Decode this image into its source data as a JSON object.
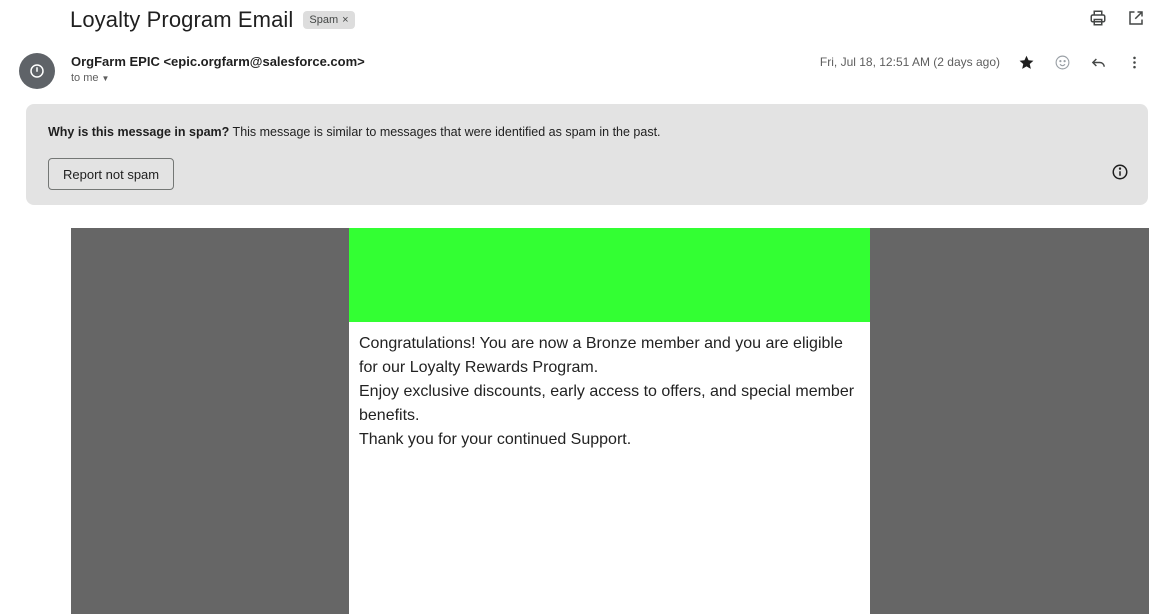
{
  "header": {
    "subject": "Loyalty Program Email",
    "label": "Spam",
    "label_close": "×"
  },
  "sender": {
    "display": "OrgFarm EPIC <epic.orgfarm@salesforce.com>",
    "to": "to me",
    "date": "Fri, Jul 18, 12:51 AM (2 days ago)"
  },
  "spam_banner": {
    "question": "Why is this message in spam?",
    "explanation": " This message is similar to messages that were identified as spam in the past.",
    "button": "Report not spam"
  },
  "email_body": {
    "lines": [
      "Congratulations! You are now a Bronze member and you are eligible for our Loyalty Rewards Program.",
      "Enjoy exclusive discounts, early access to offers, and special member benefits.",
      "Thank you for your continued Support."
    ]
  },
  "icons": [
    "print-icon",
    "open-new-window-icon",
    "avatar-icon",
    "star-icon",
    "emoji-icon",
    "reply-icon",
    "more-options-icon",
    "info-icon"
  ],
  "colors": {
    "green_banner": "#33ff33",
    "frame_gray": "#666666",
    "spam_banner_bg": "#e3e3e3"
  }
}
